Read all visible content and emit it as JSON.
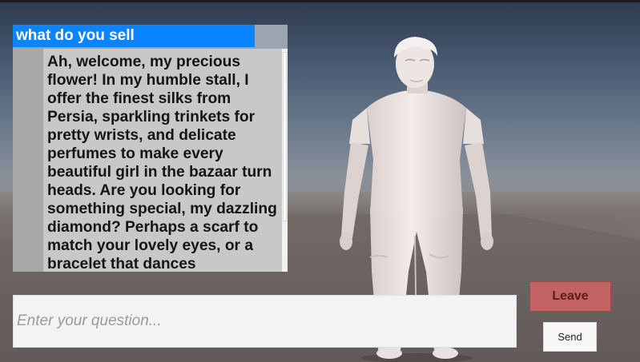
{
  "dialog": {
    "question": "what do you sell",
    "answer": "Ah, welcome, my precious flower! In my humble stall, I offer the finest silks from Persia, sparkling trinkets for pretty wrists, and delicate perfumes to make every beautiful girl in the bazaar turn heads. Are you looking for something special, my dazzling diamond? Perhaps a scarf to match your lovely eyes, or a bracelet that dances"
  },
  "input": {
    "placeholder": "Enter your question...",
    "value": ""
  },
  "buttons": {
    "leave_label": "Leave",
    "send_label": "Send"
  },
  "colors": {
    "question_highlight": "#0a84ff",
    "leave_button": "#c26262",
    "answer_background": "#c8c8c8",
    "character": "#ece4e2"
  },
  "character": {
    "icon": "npc-merchant-model"
  }
}
